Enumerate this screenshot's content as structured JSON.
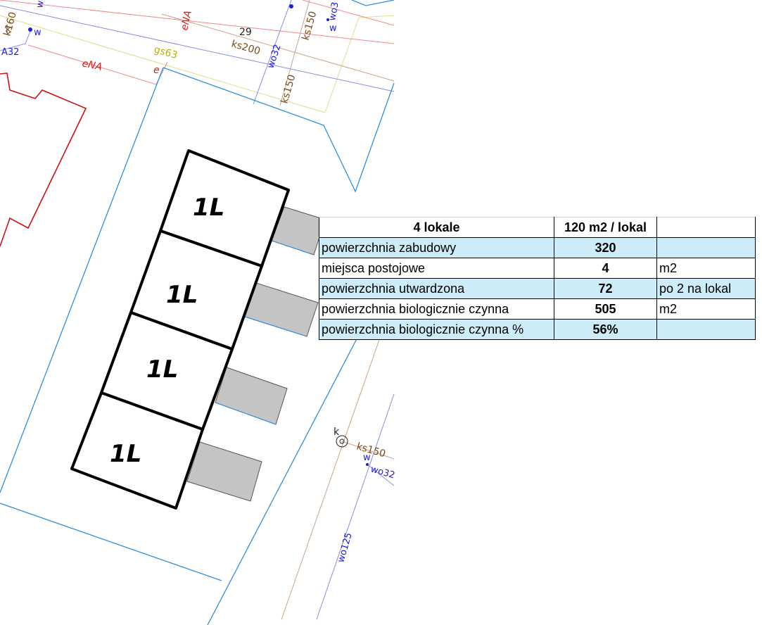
{
  "map": {
    "unit_label": "1L",
    "pipe_labels": {
      "wo_top": "wo",
      "k160": "k160",
      "k_small": "k",
      "a32": "A32",
      "w_left": "w",
      "ena_upper": "eNA",
      "ena_lower": "eNA",
      "e_small": "e",
      "gs63": "gs63",
      "num29": "29",
      "ks200": "ks200",
      "wo32_top": "wo32",
      "ks150_upper": "ks150",
      "ks150_lower": "ks150",
      "wo3_top": "wo3",
      "w_top_right": "w",
      "k_bottom": "k",
      "ks150_bottom": "ks150",
      "w_bottom": "w",
      "wo32_bottom": "wo32",
      "wo125": "wo125"
    },
    "colors": {
      "plot_boundary": "#2e8fe0",
      "building_outline": "#c81414",
      "units_outline": "#000000",
      "parking": "#c4c4c4",
      "gas_line": "#e0dc8a",
      "power_line": "#f08a8a",
      "sewer_line": "#c9a48a",
      "water_line": "#8a8ae8"
    }
  },
  "table": {
    "header": [
      "4 lokale",
      "120 m2 / lokal",
      ""
    ],
    "rows": [
      {
        "label": "powierzchnia zabudowy",
        "value": "320",
        "unit": "",
        "highlight": true
      },
      {
        "label": "miejsca postojowe",
        "value": "4",
        "unit": "m2",
        "highlight": false
      },
      {
        "label": "powierzchnia utwardzona",
        "value": "72",
        "unit": "po 2 na lokal",
        "highlight": true
      },
      {
        "label": "powierzchnia biologicznie czynna",
        "value": "505",
        "unit": "m2",
        "highlight": false
      },
      {
        "label": "powierzchnia biologicznie czynna %",
        "value": "56%",
        "unit": "",
        "highlight": true
      }
    ]
  }
}
